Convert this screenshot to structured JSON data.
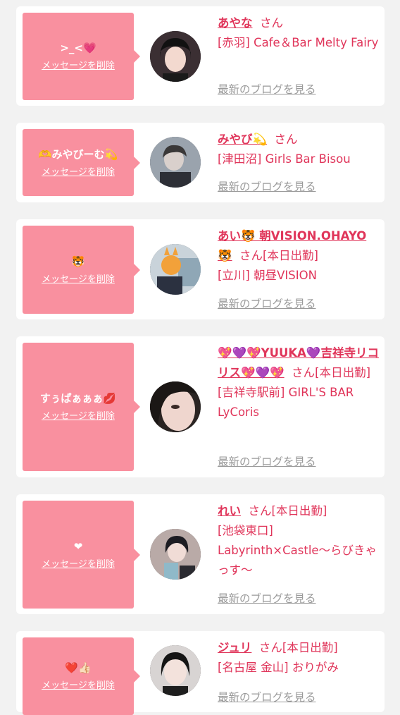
{
  "delete_label": "メッセージを削除",
  "blog_label": "最新のブログを見る",
  "san": "さん",
  "colors": {
    "page_bg": "#f2f2f2",
    "card_bg": "#ffffff",
    "bubble_bg": "#f9909f",
    "accent": "#e0355a",
    "muted": "#9a9a9a"
  },
  "cards": [
    {
      "message": ">_<💗",
      "name": "あやな",
      "status": "",
      "shop": "[赤羽] Cafe＆Bar Melty Fairy",
      "avatar": "avatar-icon"
    },
    {
      "message": "🫶みやびーむ💫",
      "name": "みやび💫",
      "status": "",
      "shop": "[津田沼] Girls Bar Bisou",
      "avatar": "avatar-icon"
    },
    {
      "message": "🐯",
      "name": "あい🐯 朝VISION.OHAYO🐯",
      "status": "[本日出勤]",
      "shop": "[立川] 朝昼VISION",
      "avatar": "avatar-icon"
    },
    {
      "message": "すぅぱぁぁぁ💋",
      "name": "💖💜💖YUUKA💜吉祥寺リコリス💖💜💖",
      "status": "[本日出勤]",
      "shop": "[吉祥寺駅前] GIRL'S BAR LyCoris",
      "avatar": "avatar-icon"
    },
    {
      "message": "❤",
      "name": "れい",
      "status": "[本日出勤]",
      "shop": "[池袋東口] Labyrinth×Castle〜らびきゃっす〜",
      "avatar": "avatar-icon"
    },
    {
      "message": "❤️👍🏻",
      "name": "ジュリ",
      "status": "[本日出勤]",
      "shop": "[名古屋 金山] おりがみ",
      "avatar": "avatar-icon"
    }
  ]
}
